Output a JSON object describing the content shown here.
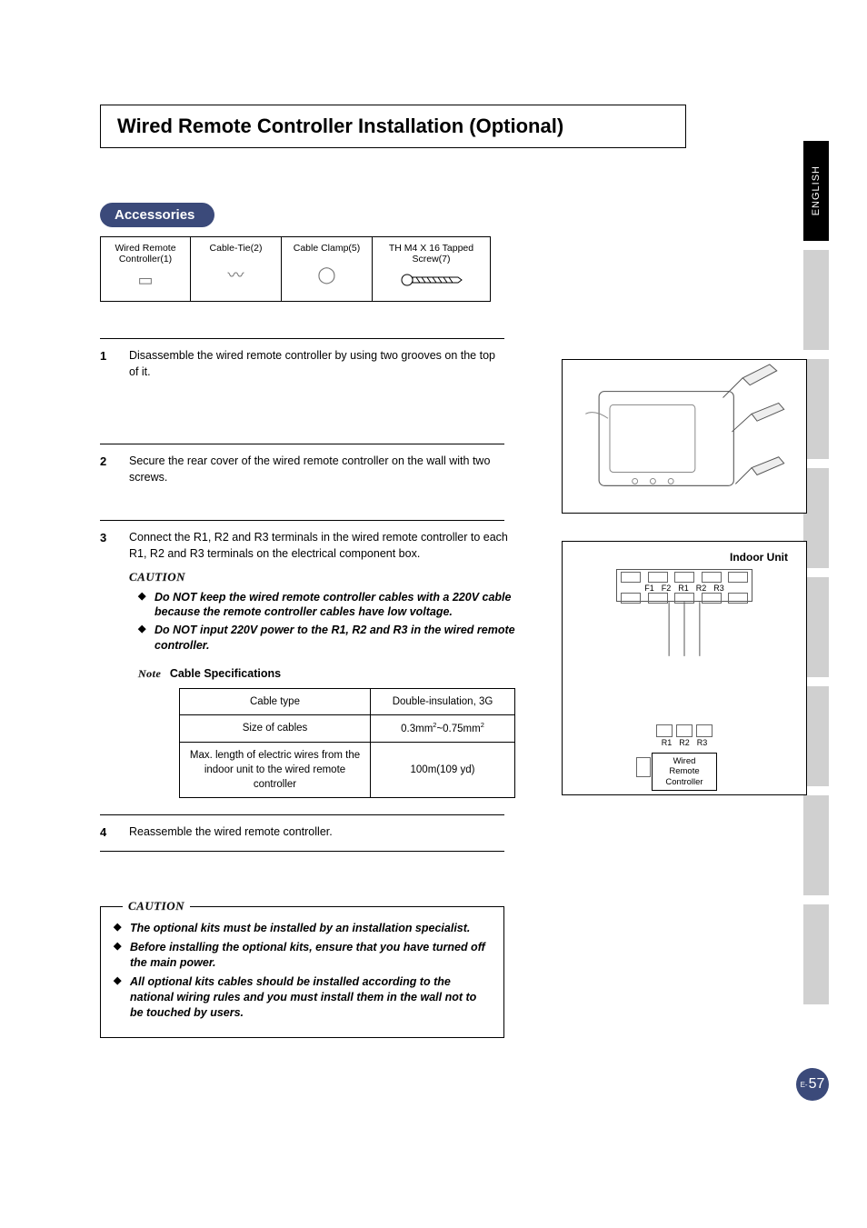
{
  "title": "Wired Remote Controller Installation (Optional)",
  "lang_tab": "ENGLISH",
  "accessories_heading": "Accessories",
  "accessories": [
    {
      "label": "Wired Remote Controller(1)"
    },
    {
      "label": "Cable-Tie(2)"
    },
    {
      "label": "Cable Clamp(5)"
    },
    {
      "label": "TH M4 X 16 Tapped Screw(7)"
    }
  ],
  "steps": {
    "s1": {
      "num": "1",
      "text": "Disassemble the wired remote controller by using two grooves on the top of it."
    },
    "s2": {
      "num": "2",
      "text": "Secure the rear cover of the wired remote controller on the wall with two screws."
    },
    "s3": {
      "num": "3",
      "text": "Connect the R1, R2 and R3 terminals in the wired remote controller to each R1, R2 and R3 terminals on the electrical component box.",
      "caution_label": "CAUTION",
      "cautions": [
        "Do NOT keep the wired remote controller cables with a 220V cable because  the remote controller cables have low voltage.",
        "Do NOT input 220V power to the R1, R2 and R3 in the wired remote controller."
      ],
      "note_label": "Note",
      "note_title": "Cable Specifications",
      "spec_table": {
        "rows": [
          [
            "Cable type",
            "Double-insulation, 3G"
          ],
          [
            "Size of cables",
            "0.3mm²~0.75mm²"
          ],
          [
            "Max. length of electric wires from the indoor unit to the wired remote controller",
            "100m(109 yd)"
          ]
        ]
      }
    },
    "s4": {
      "num": "4",
      "text": "Reassemble the wired remote controller."
    }
  },
  "caution_box": {
    "label": "CAUTION",
    "items": [
      "The optional kits must be installed by an installation specialist.",
      "Before installing the optional kits, ensure that you have turned off the main power.",
      "All optional kits cables should be installed according to the national wiring rules and you must install them in the wall not to be touched by users."
    ]
  },
  "figure2": {
    "indoor_unit": "Indoor Unit",
    "upper_terminals": [
      "F1",
      "F2",
      "R1",
      "R2",
      "R3"
    ],
    "lower_terminals": [
      "R1",
      "R2",
      "R3"
    ],
    "remote_label_l1": "Wired",
    "remote_label_l2": "Remote",
    "remote_label_l3": "Controller"
  },
  "page_number": {
    "prefix": "E-",
    "num": "57"
  }
}
